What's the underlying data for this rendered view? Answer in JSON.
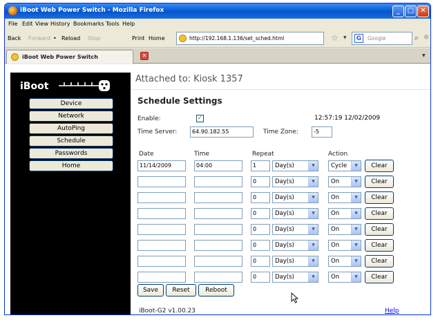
{
  "window": {
    "title": "iBoot Web Power Switch - Mozilla Firefox"
  },
  "menu": [
    "File",
    "Edit",
    "View",
    "History",
    "Bookmarks",
    "Tools",
    "Help"
  ],
  "navigation": {
    "back": "Back",
    "forward": "Forward",
    "reload": "Reload",
    "stop": "Stop",
    "print": "Print",
    "home": "Home",
    "url": "http://192.168.1.136/set_sched.html",
    "search_placeholder": "Google"
  },
  "tab": {
    "label": "iBoot Web Power Switch"
  },
  "sidebar": {
    "logo": "iBoot",
    "items": [
      "Device",
      "Network",
      "AutoPing",
      "Schedule",
      "Passwords",
      "Home"
    ]
  },
  "page": {
    "attached": "Attached to: Kiosk 1357",
    "heading": "Schedule Settings",
    "enable_label": "Enable:",
    "enabled": true,
    "datetime": "12:57:19 12/02/2009",
    "time_server_label": "Time Server:",
    "time_server": "64.90.182.55",
    "time_zone_label": "Time Zone:",
    "time_zone": "-5"
  },
  "schedule": {
    "headers": {
      "date": "Date",
      "time": "Time",
      "repeat": "Repeat",
      "action": "Action"
    },
    "rows": [
      {
        "date": "11/14/2009",
        "time": "04:00",
        "repeat": "1",
        "unit": "Day(s)",
        "action": "Cycle",
        "clear": "Clear"
      },
      {
        "date": "",
        "time": "",
        "repeat": "0",
        "unit": "Day(s)",
        "action": "On",
        "clear": "Clear"
      },
      {
        "date": "",
        "time": "",
        "repeat": "0",
        "unit": "Day(s)",
        "action": "On",
        "clear": "Clear"
      },
      {
        "date": "",
        "time": "",
        "repeat": "0",
        "unit": "Day(s)",
        "action": "On",
        "clear": "Clear"
      },
      {
        "date": "",
        "time": "",
        "repeat": "0",
        "unit": "Day(s)",
        "action": "On",
        "clear": "Clear"
      },
      {
        "date": "",
        "time": "",
        "repeat": "0",
        "unit": "Day(s)",
        "action": "On",
        "clear": "Clear"
      },
      {
        "date": "",
        "time": "",
        "repeat": "0",
        "unit": "Day(s)",
        "action": "On",
        "clear": "Clear"
      },
      {
        "date": "",
        "time": "",
        "repeat": "0",
        "unit": "Day(s)",
        "action": "On",
        "clear": "Clear"
      }
    ]
  },
  "buttons": {
    "save": "Save",
    "reset": "Reset",
    "reboot": "Reboot"
  },
  "footer": {
    "version": "iBoot-G2 v1.00.23",
    "help": "Help"
  }
}
